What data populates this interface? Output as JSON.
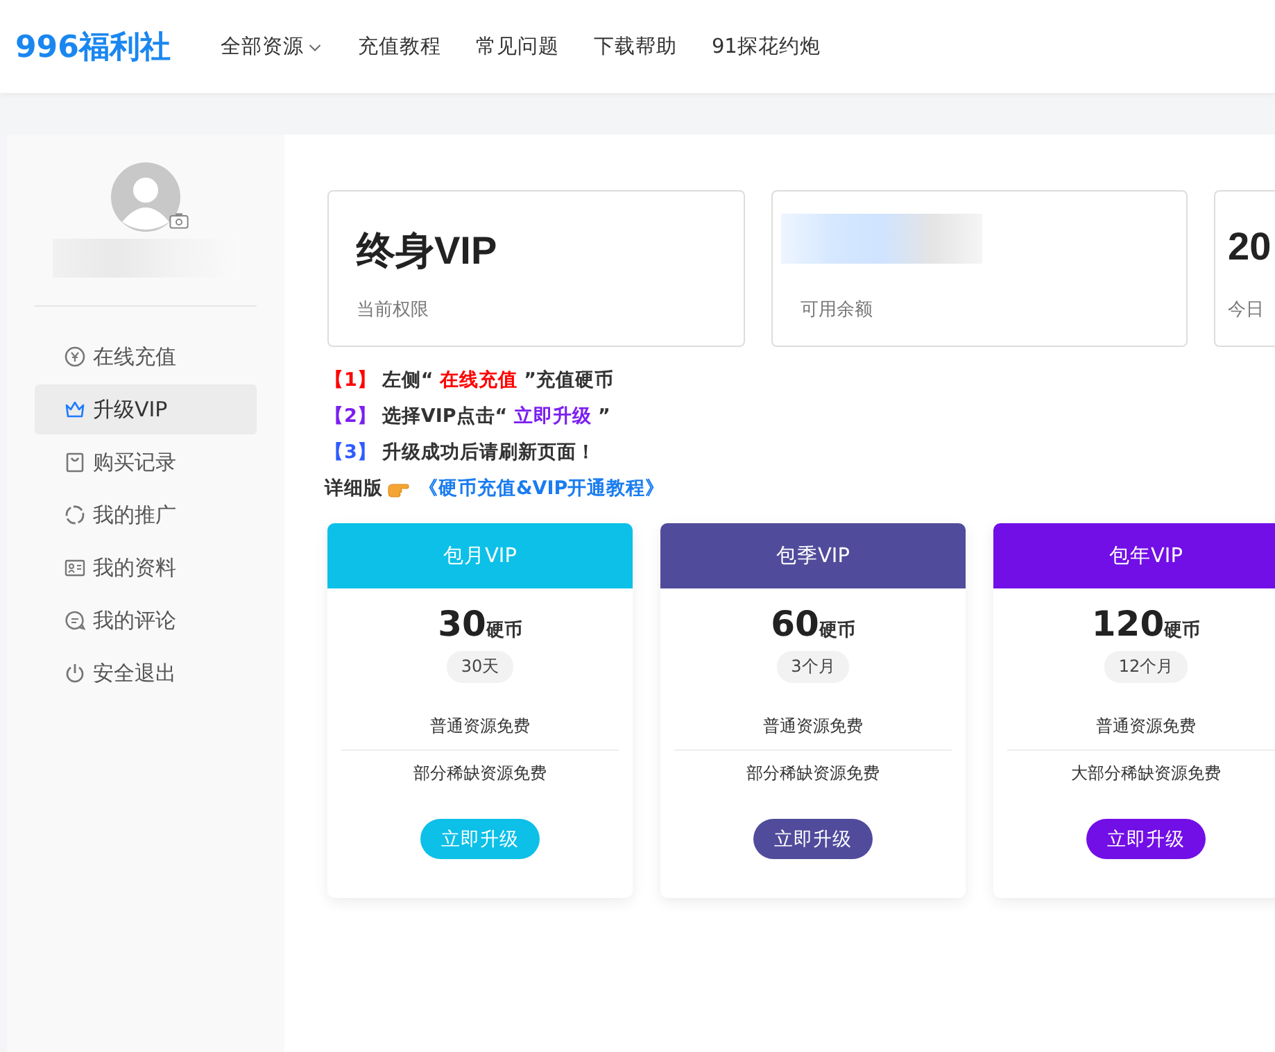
{
  "header": {
    "logo": "996福利社",
    "nav": [
      {
        "label": "全部资源",
        "dropdown": true
      },
      {
        "label": "充值教程",
        "dropdown": false
      },
      {
        "label": "常见问题",
        "dropdown": false
      },
      {
        "label": "下载帮助",
        "dropdown": false
      },
      {
        "label": "91探花约炮",
        "dropdown": false
      }
    ]
  },
  "sidebar": {
    "items": [
      {
        "label": "在线充值",
        "selected": false
      },
      {
        "label": "升级VIP",
        "selected": true
      },
      {
        "label": "购买记录",
        "selected": false
      },
      {
        "label": "我的推广",
        "selected": false
      },
      {
        "label": "我的资料",
        "selected": false
      },
      {
        "label": "我的评论",
        "selected": false
      },
      {
        "label": "安全退出",
        "selected": false
      }
    ]
  },
  "stats": [
    {
      "value": "终身VIP",
      "label": "当前权限"
    },
    {
      "label": "可用余额"
    },
    {
      "value": "20",
      "label": "今日"
    }
  ],
  "steps": [
    {
      "number": "【1】",
      "color": "#ff0000",
      "parts": [
        {
          "text": "左侧“ ",
          "highlight": false
        },
        {
          "text": "在线充值",
          "highlight": true
        },
        {
          "text": " ”充值硬币",
          "highlight": false
        }
      ]
    },
    {
      "number": "【2】",
      "color": "#7b1ff0",
      "parts": [
        {
          "text": "选择VIP点击“ ",
          "highlight": false
        },
        {
          "text": "立即升级",
          "highlight": true
        },
        {
          "text": " ”",
          "highlight": false
        }
      ]
    },
    {
      "number": "【3】",
      "color": "#2f5bff",
      "parts": [
        {
          "text": "升级成功后请刷新页面！",
          "highlight": false
        }
      ]
    }
  ],
  "detail": {
    "label": "详细版",
    "link": "《硬币充值&VIP开通教程》"
  },
  "plans": [
    {
      "title": "包月VIP",
      "color": "#0cc0e8",
      "price": "30",
      "unit": "硬币",
      "duration": "30天",
      "features": [
        "普通资源免费",
        "部分稀缺资源免费"
      ],
      "button": "立即升级"
    },
    {
      "title": "包季VIP",
      "color": "#514b9c",
      "price": "60",
      "unit": "硬币",
      "duration": "3个月",
      "features": [
        "普通资源免费",
        "部分稀缺资源免费"
      ],
      "button": "立即升级"
    },
    {
      "title": "包年VIP",
      "color": "#720ee6",
      "price": "120",
      "unit": "硬币",
      "duration": "12个月",
      "features": [
        "普通资源免费",
        "大部分稀缺资源免费"
      ],
      "button": "立即升级"
    }
  ]
}
